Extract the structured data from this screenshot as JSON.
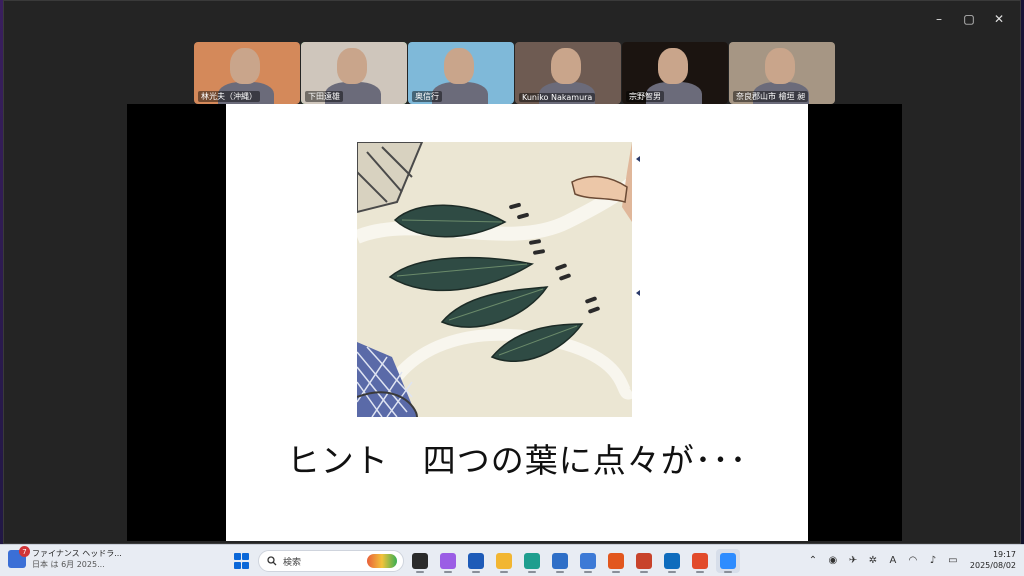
{
  "window": {
    "controls": {
      "minimize": "–",
      "maximize": "▢",
      "close": "✕"
    }
  },
  "participants": [
    {
      "name": "林光夫（沖縄）",
      "active": false,
      "bg": "#d4895a"
    },
    {
      "name": "下田遠雄",
      "active": true,
      "bg": "#cfc6bc"
    },
    {
      "name": "奥信行",
      "active": false,
      "bg": "#7fb9d9"
    },
    {
      "name": "Kuniko Nakamura",
      "active": false,
      "bg": "#6e5b52"
    },
    {
      "name": "宗野智男",
      "active": false,
      "bg": "#1b1410"
    },
    {
      "name": "奈良郡山市 檜垣 昶",
      "active": false,
      "bg": "#a69684"
    }
  ],
  "slide": {
    "hint_text": "ヒント　四つの葉に点々が･･･"
  },
  "taskbar": {
    "news": {
      "badge": "7",
      "title": "ファイナンス ヘッドラ...",
      "subtitle": "日本 は 6月 2025..."
    },
    "search_placeholder": "検索",
    "apps": [
      {
        "name": "task-view",
        "color": "#2b2b2b",
        "active": false
      },
      {
        "name": "copilot",
        "color": "#9b5de5",
        "active": false
      },
      {
        "name": "word",
        "color": "#1e5bb8",
        "active": false
      },
      {
        "name": "file-explorer",
        "color": "#f2b632",
        "active": false
      },
      {
        "name": "edge",
        "color": "#1f9e8f",
        "active": false
      },
      {
        "name": "store",
        "color": "#2f6fc7",
        "active": false
      },
      {
        "name": "outlook-calendar",
        "color": "#3d7ad6",
        "active": false
      },
      {
        "name": "app-orange",
        "color": "#e2571e",
        "active": false
      },
      {
        "name": "powerpoint",
        "color": "#c8432b",
        "active": false
      },
      {
        "name": "outlook",
        "color": "#0f6cbd",
        "active": false
      },
      {
        "name": "app-red",
        "color": "#e24b2b",
        "active": false
      },
      {
        "name": "zoom",
        "color": "#2d8cff",
        "active": true
      }
    ],
    "clock": {
      "time": "19:17",
      "date": "2025/08/02"
    }
  }
}
